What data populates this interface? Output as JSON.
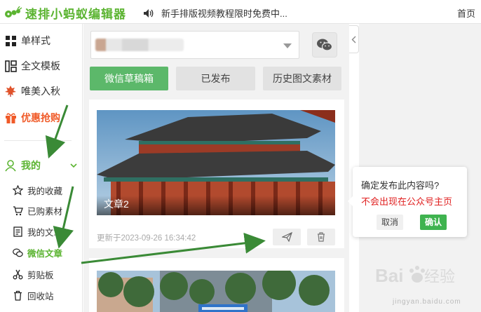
{
  "app": {
    "title": "速排小蚂蚁编辑器",
    "announcement": "新手排版视频教程限时免费中...",
    "home_link": "首页",
    "brand_color": "#5bb431"
  },
  "sidebar": {
    "items": [
      {
        "label": "单样式",
        "icon": "single-style-icon"
      },
      {
        "label": "全文模板",
        "icon": "template-icon"
      },
      {
        "label": "唯美入秋",
        "icon": "maple-leaf-icon"
      },
      {
        "label": "优惠抢购",
        "icon": "gift-icon"
      }
    ],
    "mine": {
      "label": "我的",
      "icon": "user-icon"
    },
    "sub_items": [
      {
        "label": "我的收藏",
        "icon": "star-icon"
      },
      {
        "label": "已购素材",
        "icon": "cart-icon"
      },
      {
        "label": "我的文章",
        "icon": "document-icon"
      },
      {
        "label": "微信文章",
        "icon": "wechat-icon"
      },
      {
        "label": "剪贴板",
        "icon": "scissors-icon"
      },
      {
        "label": "回收站",
        "icon": "trash-icon"
      }
    ]
  },
  "tabs": {
    "draft": "微信草稿箱",
    "published": "已发布",
    "history": "历史图文素材"
  },
  "article": {
    "title": "文章2",
    "updated": "更新于2023-09-26 16:34:42"
  },
  "popover": {
    "question": "确定发布此内容吗?",
    "warning": "不会出现在公众号主页",
    "cancel": "取消",
    "confirm": "确认"
  },
  "watermark": {
    "text": "Baidu经验",
    "sub": "jingyan.baidu.com"
  }
}
